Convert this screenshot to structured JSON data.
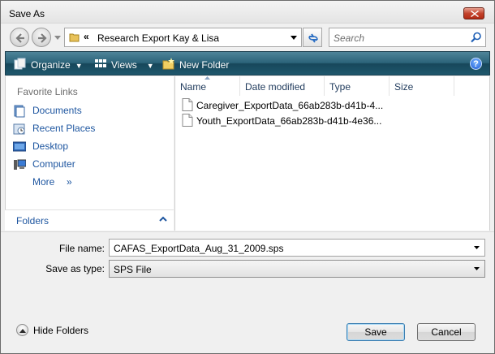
{
  "window": {
    "title": "Save As"
  },
  "address_bar": {
    "chevron": "«",
    "path": "Research Export Kay & Lisa"
  },
  "search": {
    "placeholder": "Search"
  },
  "toolbar": {
    "organize_label": "Organize",
    "views_label": "Views",
    "new_folder_label": "New Folder",
    "help_label": "?"
  },
  "favorites": {
    "header": "Favorite Links",
    "items": [
      {
        "label": "Documents",
        "icon": "documents-icon"
      },
      {
        "label": "Recent Places",
        "icon": "recent-places-icon"
      },
      {
        "label": "Desktop",
        "icon": "desktop-icon"
      },
      {
        "label": "Computer",
        "icon": "computer-icon"
      }
    ],
    "more_label": "More",
    "more_arrow": "»",
    "folders_label": "Folders"
  },
  "file_list": {
    "columns": [
      "Name",
      "Date modified",
      "Type",
      "Size"
    ],
    "files": [
      {
        "name": "Caregiver_ExportData_66ab283b-d41b-4..."
      },
      {
        "name": "Youth_ExportData_66ab283b-d41b-4e36..."
      }
    ]
  },
  "form": {
    "file_name_label": "File name:",
    "file_name_value": "CAFAS_ExportData_Aug_31_2009.sps",
    "save_type_label": "Save as type:",
    "save_type_value": "SPS File"
  },
  "footer": {
    "hide_folders_label": "Hide Folders",
    "save_label": "Save",
    "cancel_label": "Cancel"
  },
  "colors": {
    "toolbar_dark": "#17475b",
    "toolbar_light": "#4e8499",
    "link_blue": "#1e56a0",
    "close_red": "#c3432c"
  }
}
